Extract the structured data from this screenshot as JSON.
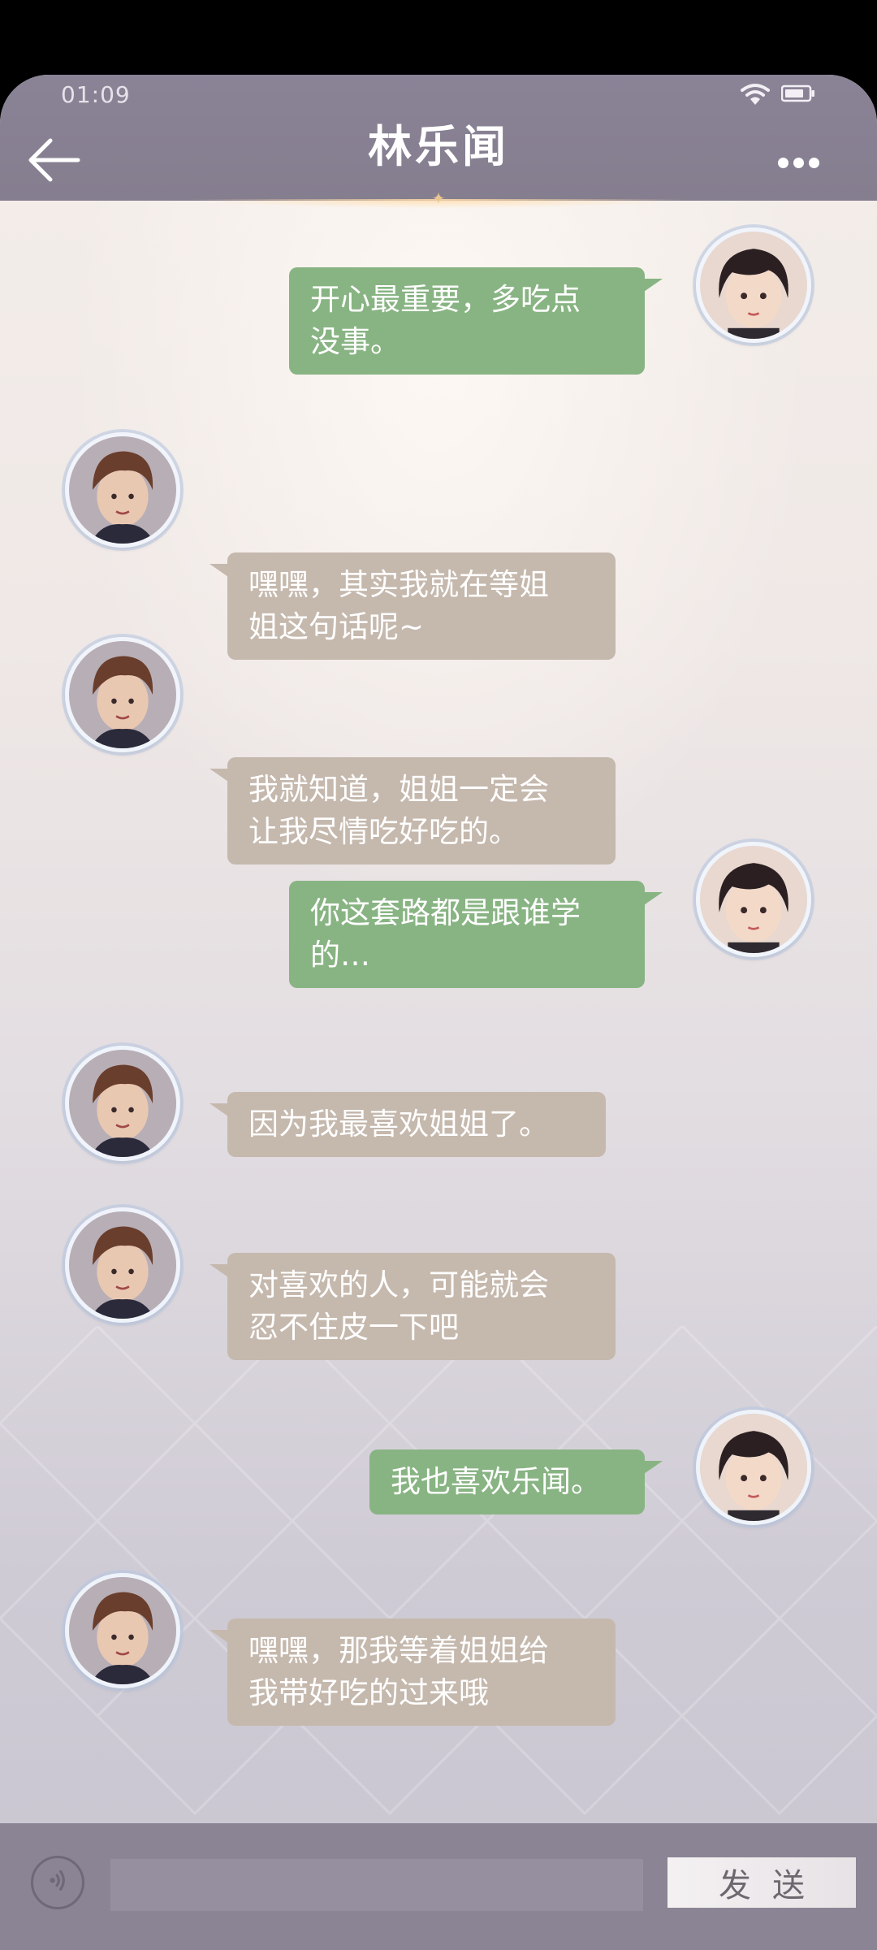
{
  "status_bar": {
    "time": "01:09"
  },
  "header": {
    "title": "林乐闻"
  },
  "colors": {
    "me_bubble": "#88b483",
    "other_bubble": "#c5b8ad",
    "header": "#857e8f"
  },
  "messages": [
    {
      "sender": "me",
      "lines": [
        "开心最重要，多吃点",
        "没事。"
      ]
    },
    {
      "sender": "other",
      "lines": [
        "嘿嘿，其实我就在等姐",
        "姐这句话呢~"
      ]
    },
    {
      "sender": "other",
      "lines": [
        "我就知道，姐姐一定会",
        "让我尽情吃好吃的。"
      ]
    },
    {
      "sender": "me",
      "lines": [
        "你这套路都是跟谁学",
        "的…"
      ]
    },
    {
      "sender": "other",
      "lines": [
        "因为我最喜欢姐姐了。"
      ]
    },
    {
      "sender": "other",
      "lines": [
        "对喜欢的人，可能就会",
        "忍不住皮一下吧"
      ]
    },
    {
      "sender": "me",
      "lines": [
        "我也喜欢乐闻。"
      ]
    },
    {
      "sender": "other",
      "lines": [
        "嘿嘿，那我等着姐姐给",
        "我带好吃的过来哦"
      ]
    }
  ],
  "input_bar": {
    "placeholder": "",
    "send_label": "发送",
    "voice_icon": "voice-icon"
  }
}
